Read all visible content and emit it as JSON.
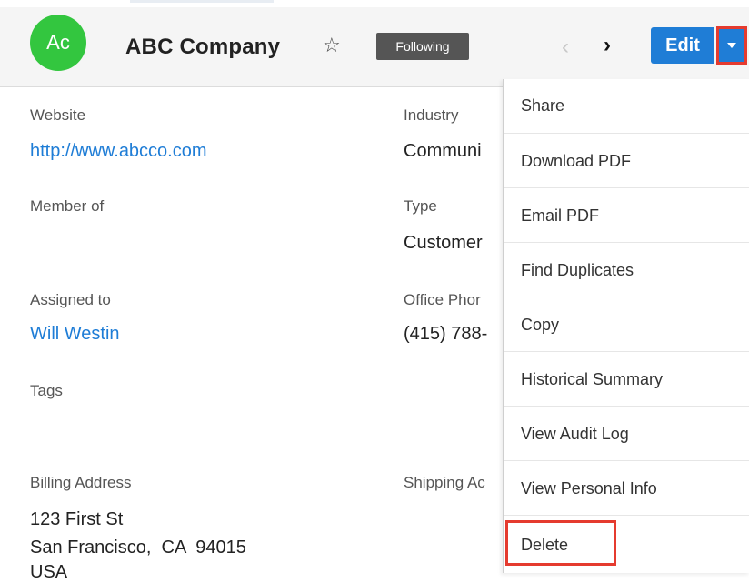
{
  "header": {
    "avatar_text": "Ac",
    "title": "ABC Company",
    "follow_label": "Following",
    "edit_label": "Edit",
    "star_icon": "star-outline-icon",
    "prev_icon": "chevron-left-icon",
    "next_icon": "chevron-right-icon",
    "caret_icon": "caret-down-icon"
  },
  "fields": {
    "website_label": "Website",
    "website_value": "http://www.abcco.com",
    "industry_label": "Industry",
    "industry_value": "Communi",
    "member_label": "Member of",
    "type_label": "Type",
    "type_value": "Customer",
    "assigned_label": "Assigned to",
    "assigned_value": "Will Westin",
    "phone_label": "Office Phor",
    "phone_value": "(415) 788-",
    "tags_label": "Tags",
    "billing_label": "Billing Address",
    "billing_line1": "123 First St",
    "billing_line2": "San Francisco,  CA  94015",
    "billing_line3": "USA",
    "shipping_label": "Shipping Ac"
  },
  "menu": {
    "items": [
      "Share",
      "Download PDF",
      "Email PDF",
      "Find Duplicates",
      "Copy",
      "Historical Summary",
      "View Audit Log",
      "View Personal Info",
      "Delete"
    ]
  },
  "colors": {
    "accent": "#1f7dd6",
    "avatar": "#33c63f",
    "highlight": "#e53b2f"
  }
}
